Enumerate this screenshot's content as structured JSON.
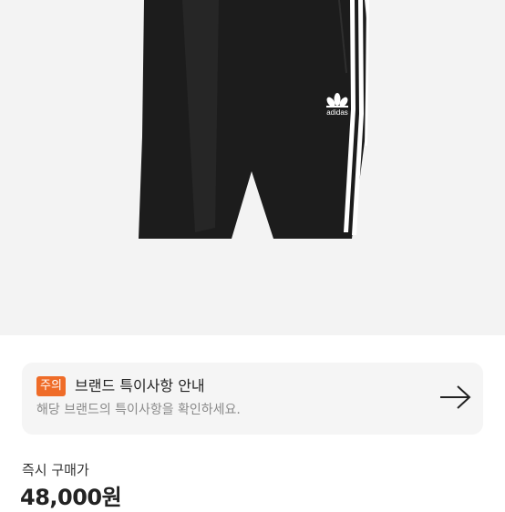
{
  "product": {
    "image_icon": "adidas-shorts-image",
    "brand_logo_text": "adidas"
  },
  "notice": {
    "badge": "주의",
    "title": "브랜드 특이사항 안내",
    "description": "해당 브랜드의 특이사항을 확인하세요.",
    "arrow_icon": "arrow-right-icon"
  },
  "price": {
    "label": "즉시 구매가",
    "value": "48,000원"
  },
  "colors": {
    "badge": "#ef6c28",
    "card_bg": "#f5f5f5",
    "hero_bg": "#f3f3f3"
  }
}
